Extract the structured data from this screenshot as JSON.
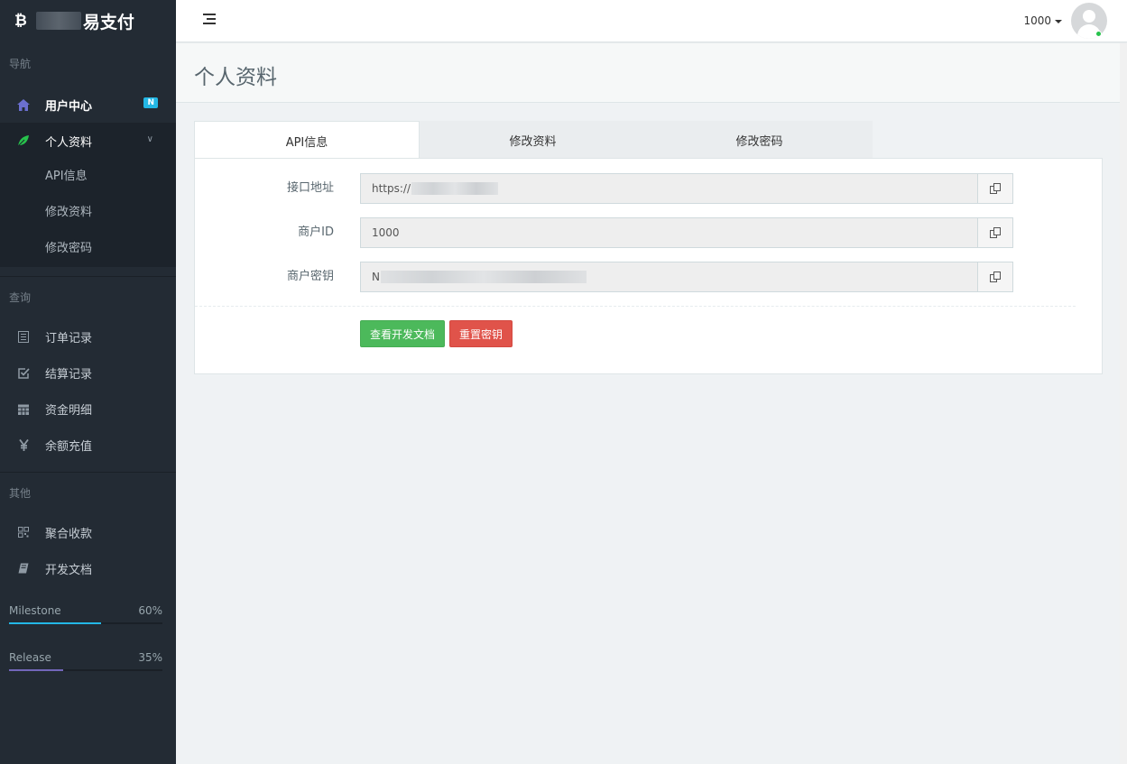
{
  "brand": {
    "logo_glyph": "₿",
    "title": "易支付"
  },
  "sidebar": {
    "sections": [
      {
        "heading": "导航"
      },
      {
        "heading": "查询"
      },
      {
        "heading": "其他"
      }
    ],
    "nav": {
      "user_center": {
        "label": "用户中心",
        "badge": "N",
        "icon": "home-icon"
      },
      "profile": {
        "label": "个人资料",
        "icon": "leaf-icon",
        "chevron": "∨",
        "children": [
          "API信息",
          "修改资料",
          "修改密码"
        ]
      },
      "orders": {
        "label": "订单记录",
        "icon": "list-icon"
      },
      "settlement": {
        "label": "结算记录",
        "icon": "checkbox-icon"
      },
      "funds": {
        "label": "资金明细",
        "icon": "calendar-icon"
      },
      "recharge": {
        "label": "余额充值",
        "icon": "yen-icon"
      },
      "aggregate": {
        "label": "聚合收款",
        "icon": "qrcode-icon"
      },
      "docs": {
        "label": "开发文档",
        "icon": "book-icon"
      }
    },
    "progress": [
      {
        "label": "Milestone",
        "percent_label": "60%",
        "fraction": 0.6,
        "color": "#23b7e5"
      },
      {
        "label": "Release",
        "percent_label": "35%",
        "fraction": 0.35,
        "color": "#7266ba"
      }
    ]
  },
  "header": {
    "user": "1000"
  },
  "page": {
    "title": "个人资料"
  },
  "tabs": [
    "API信息",
    "修改资料",
    "修改密码"
  ],
  "form": {
    "api_url": {
      "label": "接口地址",
      "value": "https://"
    },
    "merchant_id": {
      "label": "商户ID",
      "value": "1000"
    },
    "merchant_key": {
      "label": "商户密钥",
      "value": "N"
    }
  },
  "buttons": {
    "docs": "查看开发文档",
    "reset": "重置密钥"
  },
  "colors": {
    "sidebar": "#232b34",
    "accent_blue": "#23b7e5",
    "green": "#4cb95b",
    "red": "#e0534a"
  }
}
